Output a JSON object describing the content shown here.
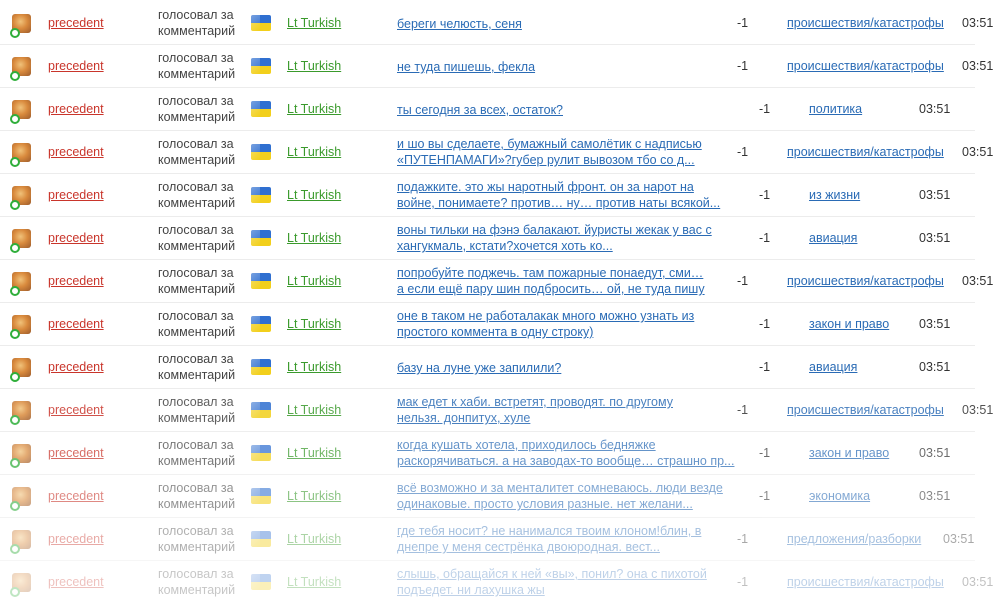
{
  "feed": [
    {
      "user": "precedent",
      "action": [
        "голосовал за",
        "комментарий"
      ],
      "target": "Lt Turkish",
      "comment": [
        "береги челюсть, сеня"
      ],
      "vote": "-1",
      "category": "происшествия/катастрофы",
      "time": "03:51"
    },
    {
      "user": "precedent",
      "action": [
        "голосовал за",
        "комментарий"
      ],
      "target": "Lt Turkish",
      "comment": [
        "не туда пишешь, фекла"
      ],
      "vote": "-1",
      "category": "происшествия/катастрофы",
      "time": "03:51"
    },
    {
      "user": "precedent",
      "action": [
        "голосовал за",
        "комментарий"
      ],
      "target": "Lt Turkish",
      "comment": [
        "ты сегодня за всех, остаток?"
      ],
      "vote": "-1",
      "category": "политика",
      "time": "03:51"
    },
    {
      "user": "precedent",
      "action": [
        "голосовал за",
        "комментарий"
      ],
      "target": "Lt Turkish",
      "comment": [
        "и шо вы сделаете, бумажный самолётик с надписью",
        "«ПУТЕНПАМАГИ»?губер рулит вывозом тбо со д..."
      ],
      "vote": "-1",
      "category": "происшествия/катастрофы",
      "time": "03:51"
    },
    {
      "user": "precedent",
      "action": [
        "голосовал за",
        "комментарий"
      ],
      "target": "Lt Turkish",
      "comment": [
        "подажките. это жы наротный фронт. он за нарот на",
        "войне, понимаете? против… ну… против наты всякой..."
      ],
      "vote": "-1",
      "category": "из жизни",
      "time": "03:51"
    },
    {
      "user": "precedent",
      "action": [
        "голосовал за",
        "комментарий"
      ],
      "target": "Lt Turkish",
      "comment": [
        "воны тильки на фэнэ балакают. йуристы жекак у вас с",
        "хангукмаль, кстати?хочется хоть ко..."
      ],
      "vote": "-1",
      "category": "авиация",
      "time": "03:51"
    },
    {
      "user": "precedent",
      "action": [
        "голосовал за",
        "комментарий"
      ],
      "target": "Lt Turkish",
      "comment": [
        "попробуйте поджечь. там пожарные понаедут, сми…",
        "а если ещё пару шин подбросить… ой, не туда пишу"
      ],
      "vote": "-1",
      "category": "происшествия/катастрофы",
      "time": "03:51"
    },
    {
      "user": "precedent",
      "action": [
        "голосовал за",
        "комментарий"
      ],
      "target": "Lt Turkish",
      "comment": [
        "оне в таком не работалакак много можно узнать из",
        "простого коммента в одну строку)"
      ],
      "vote": "-1",
      "category": "закон и право",
      "time": "03:51"
    },
    {
      "user": "precedent",
      "action": [
        "голосовал за",
        "комментарий"
      ],
      "target": "Lt Turkish",
      "comment": [
        "базу на луне уже запилили?"
      ],
      "vote": "-1",
      "category": "авиация",
      "time": "03:51"
    },
    {
      "user": "precedent",
      "action": [
        "голосовал за",
        "комментарий"
      ],
      "target": "Lt Turkish",
      "comment": [
        "мак едет к хаби. встретят, проводят. по другому",
        "нельзя. донпитух, хуле"
      ],
      "vote": "-1",
      "category": "происшествия/катастрофы",
      "time": "03:51"
    },
    {
      "user": "precedent",
      "action": [
        "голосовал за",
        "комментарий"
      ],
      "target": "Lt Turkish",
      "comment": [
        "когда кушать хотела, приходилось бедняжке",
        "раскорячиваться. а на заводах-то вообще… страшно пр..."
      ],
      "vote": "-1",
      "category": "закон и право",
      "time": "03:51"
    },
    {
      "user": "precedent",
      "action": [
        "голосовал за",
        "комментарий"
      ],
      "target": "Lt Turkish",
      "comment": [
        "всё возможно и за менталитет сомневаюсь. люди везде",
        "одинаковые. просто условия разные. нет желани..."
      ],
      "vote": "-1",
      "category": "экономика",
      "time": "03:51"
    },
    {
      "user": "precedent",
      "action": [
        "голосовал за",
        "комментарий"
      ],
      "target": "Lt Turkish",
      "comment": [
        "где тебя носит? не нанимался твоим клоном!блин, в",
        "днепре у меня сестрёнка двоюродная. вест..."
      ],
      "vote": "-1",
      "category": "предложения/разборки",
      "time": "03:51"
    },
    {
      "user": "precedent",
      "action": [
        "голосовал за",
        "комментарий"
      ],
      "target": "Lt Turkish",
      "comment": [
        "слышь, обращайся к ней «вы», понил? она с пихотой",
        "подъедет. ни лахушка жы"
      ],
      "vote": "-1",
      "category": "происшествия/катастрофы",
      "time": "03:51"
    }
  ]
}
